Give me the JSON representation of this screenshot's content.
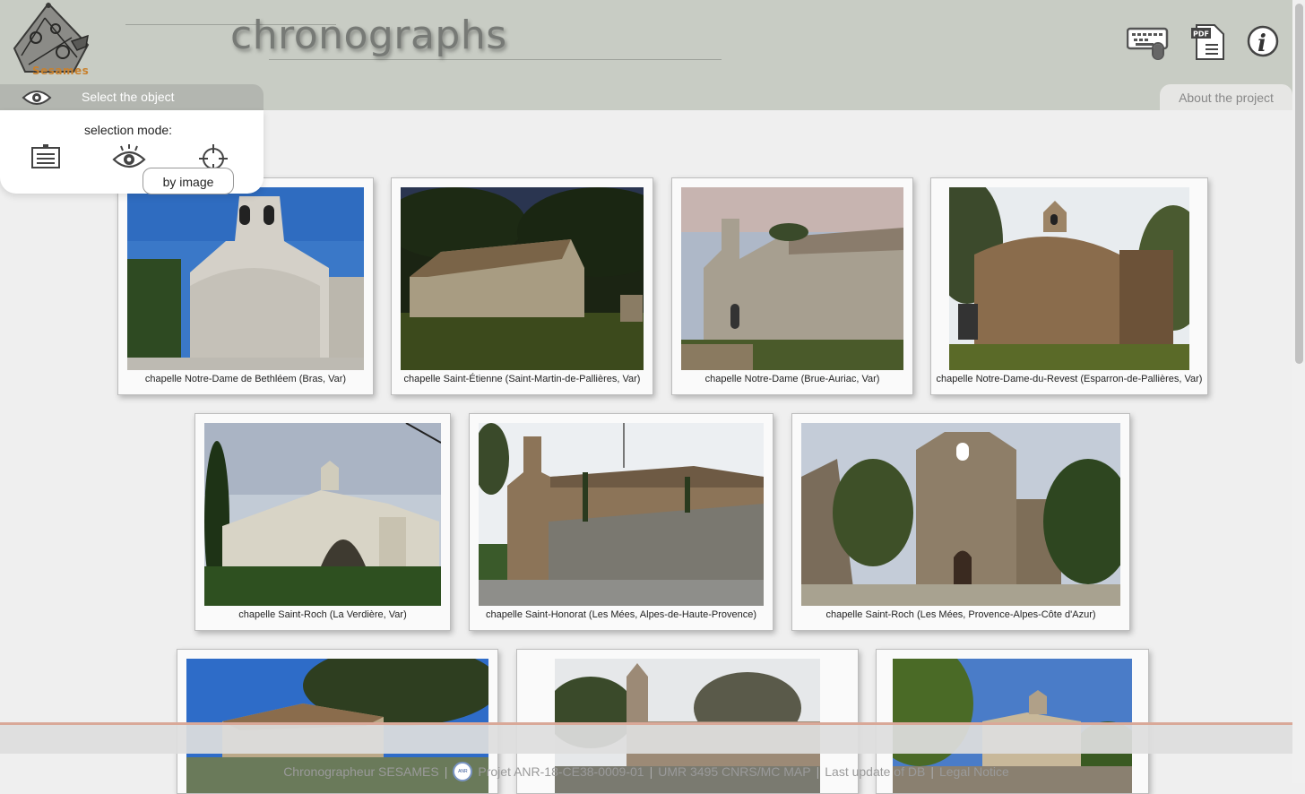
{
  "header": {
    "logo_text": "Sesames",
    "app_title": "chronographs",
    "about_tab": "About the project",
    "icons": [
      "keyboard-mouse-icon",
      "pdf-icon",
      "info-icon"
    ]
  },
  "select_panel": {
    "tab_label": "Select the object",
    "mode_label": "selection mode:",
    "modes": [
      "list-icon",
      "eye-icon",
      "crosshair-icon"
    ],
    "tooltip": "by image"
  },
  "cards": [
    {
      "caption": "chapelle Notre-Dame de Bethléem (Bras, Var)"
    },
    {
      "caption": "chapelle Saint-Étienne (Saint-Martin-de-Pallières, Var)"
    },
    {
      "caption": "chapelle Notre-Dame (Brue-Auriac, Var)"
    },
    {
      "caption": "chapelle Notre-Dame-du-Revest (Esparron-de-Pallières, Var)"
    },
    {
      "caption": "chapelle Saint-Roch (La Verdière, Var)"
    },
    {
      "caption": "chapelle Saint-Honorat (Les Mées, Alpes-de-Haute-Provence)"
    },
    {
      "caption": "chapelle Saint-Roch (Les Mées, Provence-Alpes-Côte d'Azur)"
    },
    {
      "caption": ""
    },
    {
      "caption": ""
    },
    {
      "caption": ""
    }
  ],
  "footer": {
    "credit": "Chronographeur SESAMES",
    "badge_text": "ANR",
    "project": "Projet ANR-18-CE38-0009-01",
    "lab": "UMR 3495 CNRS/MC MAP",
    "last_update": "Last update of DB",
    "legal": "Legal Notice"
  },
  "colors": {
    "header_bg": "#c8ccc4",
    "select_tab_bg": "#b3b6b0",
    "page_bg": "#efefef",
    "footer_line": "#d9a898",
    "logo_accent": "#c8812e"
  }
}
